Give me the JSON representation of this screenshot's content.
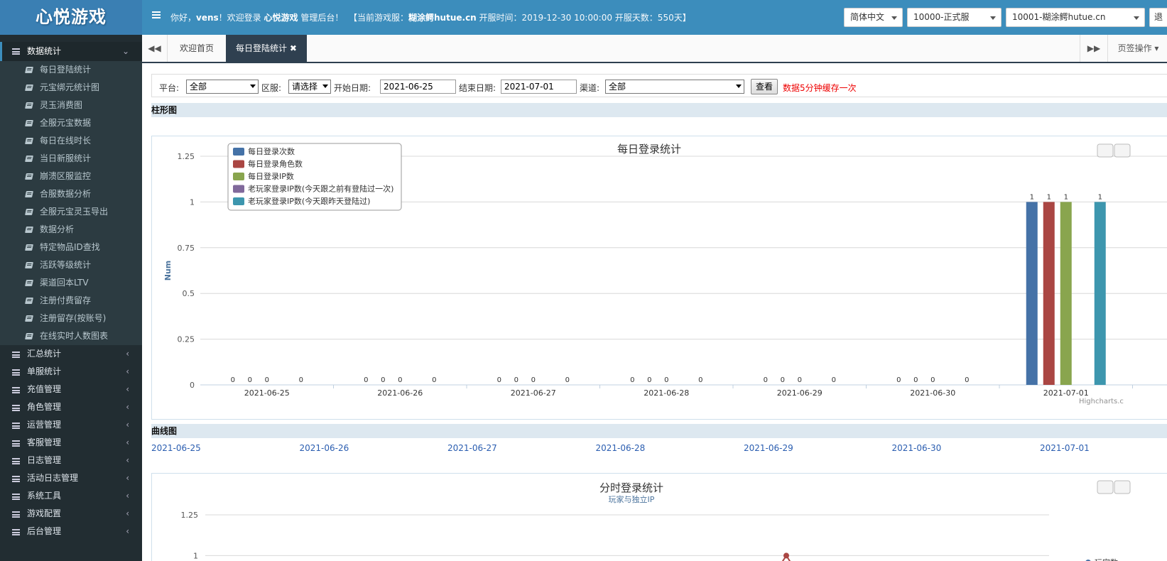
{
  "logo": "心悦游戏",
  "topbar": {
    "greeting": "你好，",
    "user": "vens",
    "welcome_mid": "！欢迎登录 ",
    "app": "心悦游戏",
    "welcome_end": " 管理后台！",
    "server_prefix": "【当前游戏服：",
    "server": "糊涂鳄hutue.cn",
    "server_info": " 开服时间：2019-12-30 10:00:00 开服天数：550天】",
    "lang_select": "简体中文",
    "zone_select": "10000-正式服",
    "server_select": "10001-糊涂鳄hutue.cn",
    "extra_btn": "退"
  },
  "sidebar": {
    "active_group": "数据统计",
    "sub_items": [
      "每日登陆统计",
      "元宝绑元统计图",
      "灵玉消费图",
      "全服元宝数据",
      "每日在线时长",
      "当日新服统计",
      "崩溃区服监控",
      "合服数据分析",
      "全服元宝灵玉导出",
      "数据分析",
      "特定物品ID查找",
      "活跃等级统计",
      "渠道回本LTV",
      "注册付费留存",
      "注册留存(按账号)",
      "在线实时人数图表"
    ],
    "groups": [
      "汇总统计",
      "单服统计",
      "充值管理",
      "角色管理",
      "运营管理",
      "客服管理",
      "日志管理",
      "活动日志管理",
      "系统工具",
      "游戏配置",
      "后台管理"
    ]
  },
  "tabs": {
    "home": "欢迎首页",
    "current": "每日登陆统计",
    "ops": "页签操作"
  },
  "filter": {
    "platform_label": "平台:",
    "platform_value": "全部",
    "zone_label": "区服:",
    "zone_value": "请选择",
    "start_label": "开始日期:",
    "start_value": "2021-06-25",
    "end_label": "结束日期:",
    "end_value": "2021-07-01",
    "channel_label": "渠道:",
    "channel_value": "全部",
    "view_button": "查看",
    "cache_note": "数据5分钟缓存一次"
  },
  "section_bar": "柱形图",
  "section_line": "曲线图",
  "date_links": [
    "2021-06-25",
    "2021-06-26",
    "2021-06-27",
    "2021-06-28",
    "2021-06-29",
    "2021-06-30",
    "2021-07-01"
  ],
  "credits": "Highcharts.c",
  "colors": {
    "blue": "#4572a7",
    "red": "#aa4643",
    "green": "#89a54e",
    "purple": "#80699b",
    "teal": "#3d96ae",
    "header": "#3c8dbc",
    "sidebar": "#222d32"
  },
  "chart_data": [
    {
      "type": "bar",
      "title": "每日登录统计",
      "ylabel": "Num",
      "xlabel": "",
      "ylim": [
        0,
        1.25
      ],
      "yticks": [
        "0",
        "0.25",
        "0.5",
        "0.75",
        "1",
        "1.25"
      ],
      "categories": [
        "2021-06-25",
        "2021-06-26",
        "2021-06-27",
        "2021-06-28",
        "2021-06-29",
        "2021-06-30",
        "2021-07-01"
      ],
      "legend_position": "top-left",
      "grid": true,
      "series": [
        {
          "name": "每日登录次数",
          "color": "#4572a7",
          "values": [
            0,
            0,
            0,
            0,
            0,
            0,
            1
          ]
        },
        {
          "name": "每日登录角色数",
          "color": "#aa4643",
          "values": [
            0,
            0,
            0,
            0,
            0,
            0,
            1
          ]
        },
        {
          "name": "每日登录IP数",
          "color": "#89a54e",
          "values": [
            0,
            0,
            0,
            0,
            0,
            0,
            1
          ]
        },
        {
          "name": "老玩家登录IP数(今天跟之前有登陆过一次)",
          "color": "#80699b",
          "values": [
            null,
            null,
            null,
            null,
            null,
            null,
            null
          ]
        },
        {
          "name": "老玩家登录IP数(今天跟昨天登陆过)",
          "color": "#3d96ae",
          "values": [
            0,
            0,
            0,
            0,
            0,
            0,
            1
          ]
        }
      ]
    },
    {
      "type": "line",
      "title": "分时登录统计",
      "subtitle": "玩家与独立IP",
      "ylim": [
        0,
        1.25
      ],
      "yticks_visible": [
        "1",
        "1.25"
      ],
      "legend_partial": "玩家数",
      "grid": true
    }
  ]
}
